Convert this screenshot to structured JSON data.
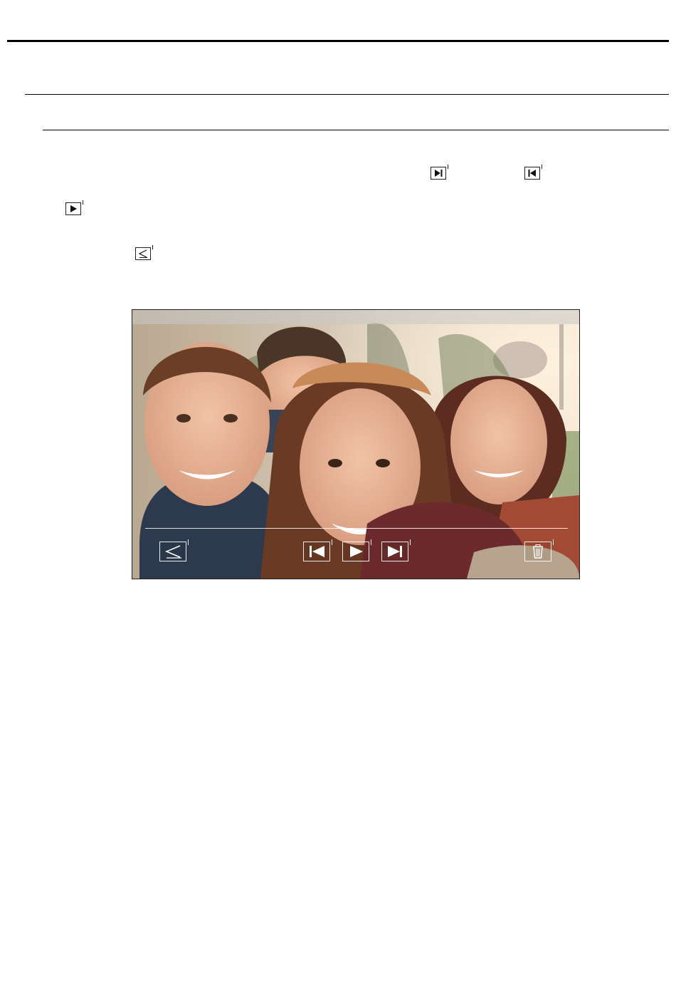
{
  "document": {
    "icons": [
      "next-icon",
      "previous-icon",
      "play-icon",
      "back-icon"
    ]
  },
  "monitor": {
    "controls": [
      {
        "name": "back-icon"
      },
      {
        "name": "previous-icon"
      },
      {
        "name": "play-icon"
      },
      {
        "name": "next-icon"
      },
      {
        "name": "trash-icon"
      }
    ],
    "colors": {
      "overlay": "#ffffff",
      "top_bar": "#c8c8c8"
    }
  }
}
